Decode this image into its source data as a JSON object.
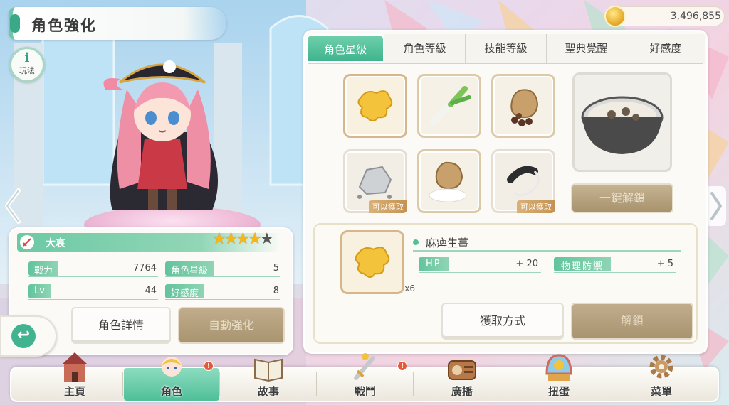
{
  "header": {
    "title": "角色強化"
  },
  "currency": {
    "amount": "3,496,855",
    "icon": "coin-icon"
  },
  "help": {
    "icon": "info-icon",
    "icon_text": "i",
    "label": "玩法"
  },
  "character": {
    "name": "大哀",
    "stars_filled": 4,
    "stars_total": 5,
    "stats": {
      "power_label": "戰力",
      "power_value": "7764",
      "star_label": "角色星級",
      "star_value": "5",
      "lv_label": "Lv",
      "lv_value": "44",
      "affection_label": "好感度",
      "affection_value": "8"
    },
    "detail_button": "角色詳情",
    "auto_button": "自動強化"
  },
  "tabs": [
    "角色星級",
    "角色等級",
    "技能等級",
    "聖典覺醒",
    "好感度"
  ],
  "active_tab": 0,
  "items": {
    "slot_tag": "可以獲取",
    "unlock_all_button": "一鍵解鎖"
  },
  "item_detail": {
    "name": "麻痺生薑",
    "quantity": "x6",
    "bonuses": [
      {
        "label": "HP",
        "value": "+ 20"
      },
      {
        "label": "物理防禦",
        "value": "+ 5"
      }
    ],
    "obtain_button": "獲取方式",
    "unlock_button": "解鎖"
  },
  "bottom_nav": [
    {
      "label": "主頁",
      "icon": "castle-icon"
    },
    {
      "label": "角色",
      "icon": "character-icon",
      "badge": "!"
    },
    {
      "label": "故事",
      "icon": "book-icon"
    },
    {
      "label": "戰鬥",
      "icon": "sword-icon",
      "badge": "!"
    },
    {
      "label": "廣播",
      "icon": "radio-icon"
    },
    {
      "label": "扭蛋",
      "icon": "gacha-icon"
    },
    {
      "label": "菜單",
      "icon": "gear-icon"
    }
  ],
  "colors": {
    "accent": "#4ebf98",
    "disabled": "#a8946f",
    "star": "#f8b516"
  }
}
